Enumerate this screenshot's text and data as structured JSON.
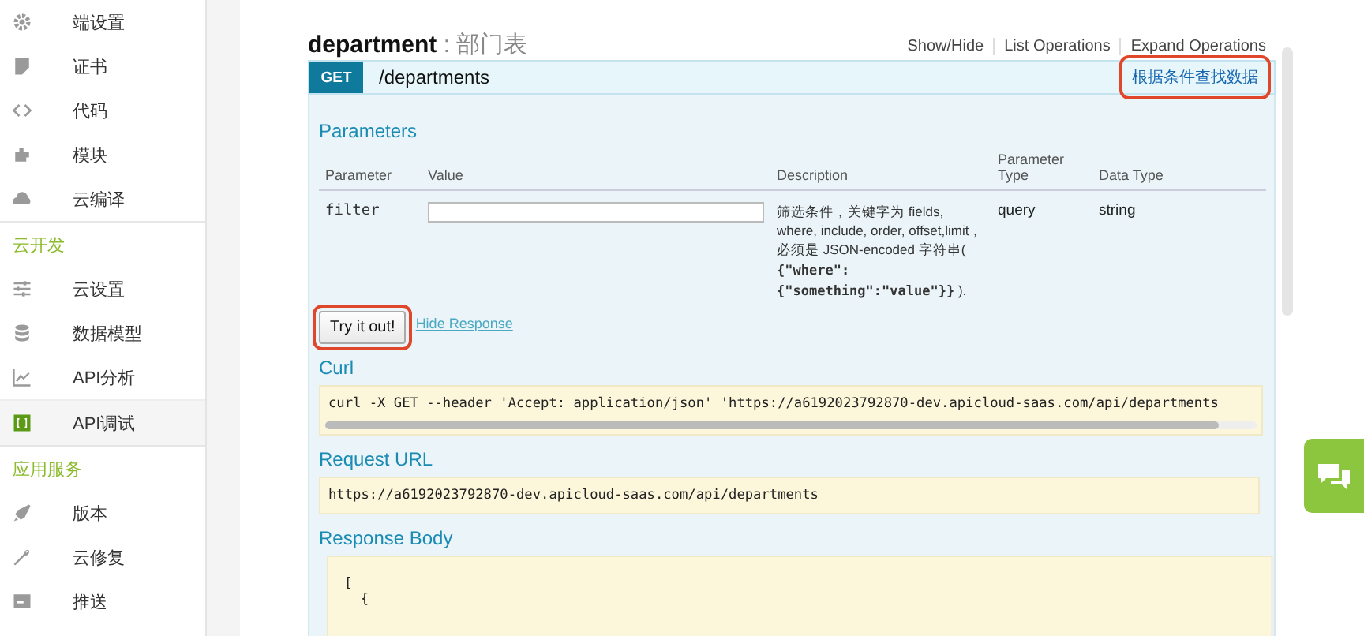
{
  "sidebar": {
    "entries": [
      {
        "kind": "item",
        "label": "端设置",
        "selected": false
      },
      {
        "kind": "item",
        "label": "证书",
        "selected": false
      },
      {
        "kind": "item",
        "label": "代码",
        "selected": false
      },
      {
        "kind": "item",
        "label": "模块",
        "selected": false
      },
      {
        "kind": "item",
        "label": "云编译",
        "selected": false
      },
      {
        "kind": "section",
        "label": "云开发"
      },
      {
        "kind": "item",
        "label": "云设置",
        "selected": false
      },
      {
        "kind": "item",
        "label": "数据模型",
        "selected": false
      },
      {
        "kind": "item",
        "label": "API分析",
        "selected": false
      },
      {
        "kind": "item",
        "label": "API调试",
        "selected": true
      },
      {
        "kind": "section",
        "label": "应用服务"
      },
      {
        "kind": "item",
        "label": "版本",
        "selected": false
      },
      {
        "kind": "item",
        "label": "云修复",
        "selected": false
      },
      {
        "kind": "item",
        "label": "推送",
        "selected": false
      }
    ]
  },
  "resource": {
    "name": "department",
    "separator": ":",
    "description": "部门表",
    "links": [
      "Show/Hide",
      "List Operations",
      "Expand Operations"
    ]
  },
  "operation": {
    "method": "GET",
    "path": "/departments",
    "summary": "根据条件查找数据",
    "summary_highlighted": true
  },
  "parameters": {
    "title": "Parameters",
    "columns": [
      "Parameter",
      "Value",
      "Description",
      "Parameter Type",
      "Data Type"
    ],
    "rows": [
      {
        "name": "filter",
        "value": "",
        "description": "筛选条件，关键字为 fields, where, include, order, offset,limit，必须是 JSON-encoded 字符串( **{\"where\": {\"something\":\"value\"}}** ).",
        "type": "query",
        "data_type": "string"
      }
    ]
  },
  "try_button": {
    "label": "Try it out!",
    "highlighted": true
  },
  "hide_link": "Hide Response",
  "curl": {
    "title": "Curl",
    "code": "curl -X GET --header 'Accept: application/json' 'https://a6192023792870-dev.apicloud-saas.com/api/departments"
  },
  "request_url": {
    "title": "Request URL",
    "code": "https://a6192023792870-dev.apicloud-saas.com/api/departments"
  },
  "response_body": {
    "title": "Response Body",
    "lines": [
      "[",
      "  {"
    ]
  }
}
